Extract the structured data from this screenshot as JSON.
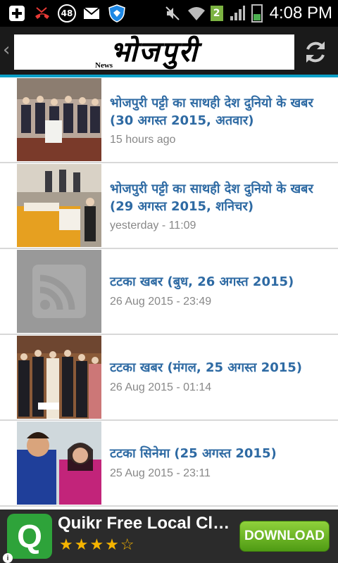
{
  "status_bar": {
    "time": "4:08 PM",
    "notification_count": "48",
    "sim_badge": "2",
    "icons": [
      "add-icon",
      "missed-call-icon",
      "count-badge",
      "mail-icon",
      "shield-icon",
      "mute-icon",
      "wifi-icon",
      "sim-2-icon",
      "signal-icon",
      "battery-icon"
    ]
  },
  "action_bar": {
    "logo_text": "भोजपुरी",
    "logo_subtext": "News",
    "back_icon": "chevron-left-icon",
    "refresh_icon": "refresh-icon"
  },
  "articles": [
    {
      "title": "भोजपुरी पट्टी का साथही देश दुनियो के खबर (30 अगस्त 2015, अतवार)",
      "date": "15 hours ago",
      "thumb": "group-photo"
    },
    {
      "title": "भोजपुरी पट्टी का साथही देश दुनियो के खबर (29 अगस्त 2015, शनिचर)",
      "date": "yesterday - 11:09",
      "thumb": "ceremony-photo"
    },
    {
      "title": "टटका खबर (बुध, 26 अगस्त 2015)",
      "date": "26 Aug 2015 - 23:49",
      "thumb": "rss-placeholder"
    },
    {
      "title": "टटका खबर (मंगल, 25 अगस्त 2015)",
      "date": "26 Aug 2015 - 01:14",
      "thumb": "group-photo-2"
    },
    {
      "title": "टटका सिनेमा (25 अगस्त 2015)",
      "date": "25 Aug 2015 - 23:11",
      "thumb": "actors-photo"
    }
  ],
  "ad": {
    "icon_letter": "Q",
    "title": "Quikr Free Local Cla...",
    "stars": "★★★★☆",
    "rating": 4,
    "button_label": "DOWNLOAD",
    "info": "i"
  },
  "colors": {
    "title_blue": "#2e6aa3",
    "accent": "#0aa0c8",
    "ad_green": "#2ea33a"
  }
}
